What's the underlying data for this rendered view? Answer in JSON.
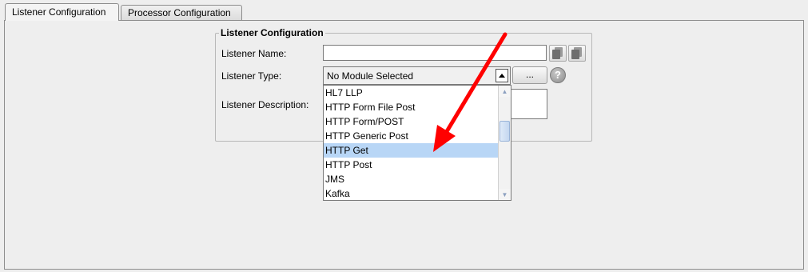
{
  "tabs": [
    {
      "label": "Listener Configuration",
      "active": true
    },
    {
      "label": "Processor Configuration",
      "active": false
    }
  ],
  "group": {
    "title": "Listener Configuration",
    "name_label": "Listener Name:",
    "name_value": "",
    "type_label": "Listener Type:",
    "type_value": "No Module Selected",
    "description_label": "Listener Description:",
    "description_value": "",
    "browse_button_label": "...",
    "help_icon": "question-mark-icon"
  },
  "dropdown": {
    "items": [
      "HL7 LLP",
      "HTTP Form File Post",
      "HTTP Form/POST",
      "HTTP Generic Post",
      "HTTP Get",
      "HTTP Post",
      "JMS",
      "Kafka"
    ],
    "selected": "HTTP Get"
  },
  "annotation": {
    "color": "#ff0000",
    "icon": "red-arrow"
  }
}
